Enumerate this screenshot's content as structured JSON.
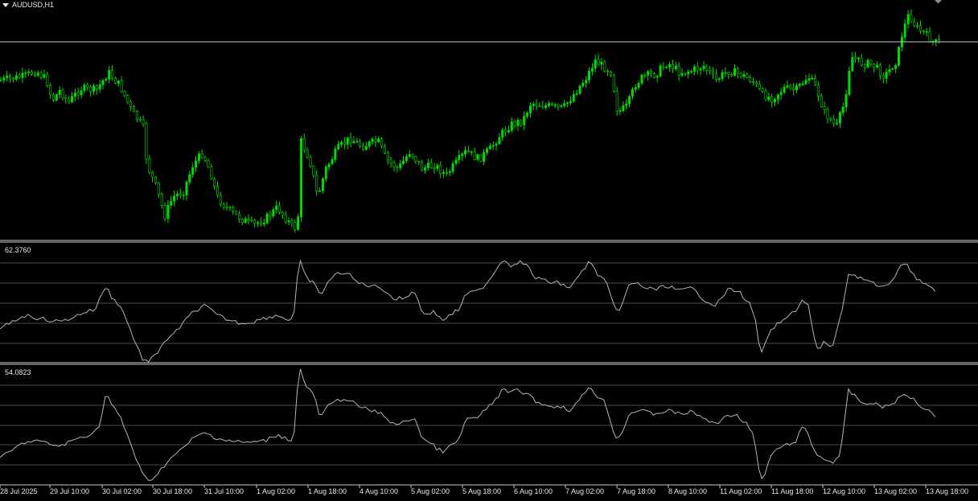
{
  "window": {
    "title": "AUDUSD,H1",
    "background": "#000000",
    "candle_color": "#00dc00",
    "indicator_line_color": "#b4b4b4",
    "grid_color": "#c8c8c8"
  },
  "icons": {
    "title_menu": "triangle-down-icon",
    "corner": "diamond-icon"
  },
  "panels": {
    "indicator1": {
      "value_label": "62.3760"
    },
    "indicator2": {
      "value_label": "54.0823"
    }
  },
  "x_axis": {
    "labels": [
      "28 Jul 2025",
      "29 Jul 10:00",
      "30 Jul 02:00",
      "30 Jul 18:00",
      "31 Jul 10:00",
      "1 Aug 02:00",
      "1 Aug 18:00",
      "4 Aug 10:00",
      "5 Aug 02:00",
      "5 Aug 18:00",
      "6 Aug 10:00",
      "7 Aug 02:00",
      "7 Aug 18:00",
      "8 Aug 10:00",
      "11 Aug 02:00",
      "11 Aug 18:00",
      "12 Aug 10:00",
      "13 Aug 02:00",
      "13 Aug 18:00"
    ]
  },
  "chart_data": [
    {
      "type": "candlestick",
      "title": "AUDUSD,H1",
      "x_labels": [
        "28 Jul 2025",
        "29 Jul 10:00",
        "30 Jul 02:00",
        "30 Jul 18:00",
        "31 Jul 10:00",
        "1 Aug 02:00",
        "1 Aug 18:00",
        "4 Aug 10:00",
        "5 Aug 02:00",
        "5 Aug 18:00",
        "6 Aug 10:00",
        "7 Aug 02:00",
        "7 Aug 18:00",
        "8 Aug 10:00",
        "11 Aug 02:00",
        "11 Aug 18:00",
        "12 Aug 10:00",
        "13 Aug 02:00",
        "13 Aug 18:00"
      ],
      "close_path": [
        [
          0,
          100
        ],
        [
          30,
          95
        ],
        [
          45,
          88
        ],
        [
          58,
          100
        ],
        [
          65,
          125
        ],
        [
          75,
          112
        ],
        [
          85,
          128
        ],
        [
          100,
          110
        ],
        [
          120,
          112
        ],
        [
          135,
          90
        ],
        [
          150,
          108
        ],
        [
          165,
          140
        ],
        [
          178,
          158
        ],
        [
          183,
          205
        ],
        [
          193,
          230
        ],
        [
          205,
          268
        ],
        [
          215,
          245
        ],
        [
          228,
          238
        ],
        [
          240,
          205
        ],
        [
          252,
          190
        ],
        [
          262,
          215
        ],
        [
          270,
          245
        ],
        [
          285,
          262
        ],
        [
          300,
          272
        ],
        [
          315,
          280
        ],
        [
          330,
          272
        ],
        [
          345,
          258
        ],
        [
          362,
          280
        ],
        [
          370,
          285
        ],
        [
          374,
          175
        ],
        [
          385,
          198
        ],
        [
          395,
          245
        ],
        [
          405,
          210
        ],
        [
          420,
          185
        ],
        [
          435,
          172
        ],
        [
          450,
          182
        ],
        [
          470,
          175
        ],
        [
          480,
          198
        ],
        [
          495,
          210
        ],
        [
          510,
          188
        ],
        [
          525,
          210
        ],
        [
          540,
          205
        ],
        [
          555,
          218
        ],
        [
          565,
          205
        ],
        [
          580,
          188
        ],
        [
          595,
          198
        ],
        [
          610,
          185
        ],
        [
          620,
          170
        ],
        [
          635,
          155
        ],
        [
          650,
          150
        ],
        [
          660,
          128
        ],
        [
          680,
          132
        ],
        [
          700,
          135
        ],
        [
          715,
          115
        ],
        [
          730,
          95
        ],
        [
          740,
          75
        ],
        [
          760,
          90
        ],
        [
          768,
          140
        ],
        [
          780,
          132
        ],
        [
          790,
          105
        ],
        [
          800,
          95
        ],
        [
          815,
          92
        ],
        [
          830,
          78
        ],
        [
          845,
          90
        ],
        [
          860,
          88
        ],
        [
          875,
          82
        ],
        [
          890,
          100
        ],
        [
          905,
          88
        ],
        [
          920,
          92
        ],
        [
          935,
          100
        ],
        [
          948,
          118
        ],
        [
          960,
          122
        ],
        [
          975,
          110
        ],
        [
          990,
          112
        ],
        [
          1005,
          95
        ],
        [
          1015,
          110
        ],
        [
          1025,
          140
        ],
        [
          1040,
          158
        ],
        [
          1050,
          128
        ],
        [
          1058,
          70
        ],
        [
          1070,
          78
        ],
        [
          1085,
          80
        ],
        [
          1100,
          95
        ],
        [
          1115,
          75
        ],
        [
          1122,
          40
        ],
        [
          1130,
          18
        ],
        [
          1140,
          35
        ],
        [
          1150,
          42
        ],
        [
          1160,
          52
        ],
        [
          1168,
          55
        ]
      ]
    },
    {
      "type": "line",
      "name": "62.3760",
      "gridlines": 5,
      "path": [
        [
          0,
          410
        ],
        [
          15,
          400
        ],
        [
          30,
          392
        ],
        [
          45,
          395
        ],
        [
          60,
          398
        ],
        [
          75,
          400
        ],
        [
          90,
          395
        ],
        [
          105,
          388
        ],
        [
          118,
          385
        ],
        [
          125,
          370
        ],
        [
          132,
          355
        ],
        [
          140,
          372
        ],
        [
          150,
          380
        ],
        [
          160,
          405
        ],
        [
          170,
          430
        ],
        [
          178,
          448
        ],
        [
          185,
          450
        ],
        [
          195,
          440
        ],
        [
          203,
          425
        ],
        [
          212,
          420
        ],
        [
          225,
          405
        ],
        [
          240,
          388
        ],
        [
          255,
          380
        ],
        [
          270,
          392
        ],
        [
          285,
          398
        ],
        [
          300,
          402
        ],
        [
          315,
          400
        ],
        [
          330,
          395
        ],
        [
          345,
          392
        ],
        [
          360,
          398
        ],
        [
          365,
          395
        ],
        [
          372,
          322
        ],
        [
          380,
          345
        ],
        [
          390,
          352
        ],
        [
          398,
          368
        ],
        [
          408,
          350
        ],
        [
          420,
          340
        ],
        [
          430,
          338
        ],
        [
          445,
          352
        ],
        [
          460,
          355
        ],
        [
          475,
          358
        ],
        [
          490,
          372
        ],
        [
          505,
          370
        ],
        [
          515,
          360
        ],
        [
          525,
          390
        ],
        [
          540,
          388
        ],
        [
          550,
          398
        ],
        [
          560,
          392
        ],
        [
          570,
          385
        ],
        [
          580,
          365
        ],
        [
          595,
          362
        ],
        [
          605,
          352
        ],
        [
          615,
          338
        ],
        [
          625,
          322
        ],
        [
          635,
          330
        ],
        [
          645,
          325
        ],
        [
          655,
          330
        ],
        [
          665,
          345
        ],
        [
          680,
          350
        ],
        [
          695,
          352
        ],
        [
          710,
          358
        ],
        [
          720,
          342
        ],
        [
          733,
          325
        ],
        [
          742,
          340
        ],
        [
          752,
          348
        ],
        [
          760,
          370
        ],
        [
          765,
          388
        ],
        [
          772,
          382
        ],
        [
          782,
          355
        ],
        [
          792,
          352
        ],
        [
          802,
          358
        ],
        [
          815,
          360
        ],
        [
          830,
          355
        ],
        [
          845,
          362
        ],
        [
          860,
          358
        ],
        [
          875,
          372
        ],
        [
          890,
          380
        ],
        [
          905,
          360
        ],
        [
          918,
          362
        ],
        [
          930,
          375
        ],
        [
          938,
          390
        ],
        [
          945,
          440
        ],
        [
          952,
          428
        ],
        [
          960,
          408
        ],
        [
          975,
          398
        ],
        [
          990,
          385
        ],
        [
          998,
          372
        ],
        [
          1005,
          380
        ],
        [
          1012,
          420
        ],
        [
          1018,
          438
        ],
        [
          1025,
          425
        ],
        [
          1035,
          432
        ],
        [
          1045,
          395
        ],
        [
          1055,
          340
        ],
        [
          1070,
          345
        ],
        [
          1085,
          352
        ],
        [
          1095,
          360
        ],
        [
          1105,
          352
        ],
        [
          1115,
          340
        ],
        [
          1125,
          325
        ],
        [
          1135,
          340
        ],
        [
          1145,
          352
        ],
        [
          1155,
          355
        ],
        [
          1165,
          362
        ]
      ]
    },
    {
      "type": "line",
      "name": "54.0823",
      "gridlines": 5,
      "path": [
        [
          0,
          570
        ],
        [
          15,
          560
        ],
        [
          30,
          550
        ],
        [
          45,
          548
        ],
        [
          60,
          552
        ],
        [
          75,
          555
        ],
        [
          90,
          548
        ],
        [
          105,
          542
        ],
        [
          118,
          538
        ],
        [
          125,
          525
        ],
        [
          132,
          488
        ],
        [
          140,
          505
        ],
        [
          150,
          520
        ],
        [
          160,
          545
        ],
        [
          170,
          572
        ],
        [
          178,
          592
        ],
        [
          185,
          598
        ],
        [
          195,
          590
        ],
        [
          203,
          580
        ],
        [
          212,
          570
        ],
        [
          225,
          560
        ],
        [
          240,
          545
        ],
        [
          255,
          538
        ],
        [
          270,
          545
        ],
        [
          285,
          548
        ],
        [
          300,
          550
        ],
        [
          315,
          550
        ],
        [
          330,
          548
        ],
        [
          345,
          540
        ],
        [
          360,
          548
        ],
        [
          365,
          545
        ],
        [
          372,
          455
        ],
        [
          380,
          480
        ],
        [
          390,
          490
        ],
        [
          398,
          520
        ],
        [
          408,
          505
        ],
        [
          420,
          498
        ],
        [
          430,
          495
        ],
        [
          445,
          505
        ],
        [
          460,
          510
        ],
        [
          475,
          515
        ],
        [
          490,
          528
        ],
        [
          505,
          525
        ],
        [
          515,
          518
        ],
        [
          525,
          545
        ],
        [
          540,
          555
        ],
        [
          550,
          562
        ],
        [
          560,
          555
        ],
        [
          570,
          548
        ],
        [
          580,
          520
        ],
        [
          595,
          520
        ],
        [
          605,
          508
        ],
        [
          615,
          498
        ],
        [
          625,
          485
        ],
        [
          635,
          488
        ],
        [
          645,
          485
        ],
        [
          655,
          490
        ],
        [
          665,
          498
        ],
        [
          680,
          505
        ],
        [
          695,
          505
        ],
        [
          710,
          510
        ],
        [
          720,
          498
        ],
        [
          733,
          480
        ],
        [
          742,
          492
        ],
        [
          752,
          500
        ],
        [
          760,
          525
        ],
        [
          765,
          545
        ],
        [
          772,
          542
        ],
        [
          782,
          515
        ],
        [
          792,
          510
        ],
        [
          802,
          512
        ],
        [
          815,
          515
        ],
        [
          830,
          510
        ],
        [
          845,
          515
        ],
        [
          860,
          512
        ],
        [
          875,
          520
        ],
        [
          890,
          528
        ],
        [
          905,
          515
        ],
        [
          918,
          518
        ],
        [
          930,
          528
        ],
        [
          938,
          545
        ],
        [
          945,
          598
        ],
        [
          952,
          588
        ],
        [
          960,
          562
        ],
        [
          975,
          555
        ],
        [
          990,
          548
        ],
        [
          998,
          530
        ],
        [
          1005,
          540
        ],
        [
          1012,
          560
        ],
        [
          1018,
          568
        ],
        [
          1025,
          570
        ],
        [
          1035,
          575
        ],
        [
          1045,
          565
        ],
        [
          1055,
          485
        ],
        [
          1070,
          500
        ],
        [
          1085,
          502
        ],
        [
          1095,
          505
        ],
        [
          1105,
          505
        ],
        [
          1115,
          498
        ],
        [
          1125,
          490
        ],
        [
          1135,
          495
        ],
        [
          1145,
          505
        ],
        [
          1155,
          510
        ],
        [
          1165,
          518
        ]
      ]
    }
  ]
}
